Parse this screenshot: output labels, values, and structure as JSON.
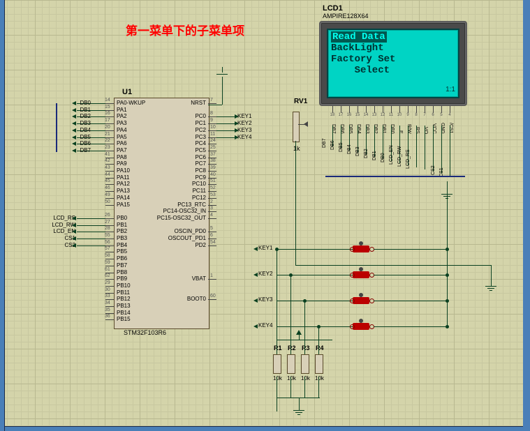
{
  "title": "第一菜单下的子菜单项",
  "lcd": {
    "ref": "LCD1",
    "part": "AMPIRE128X64",
    "lines": [
      "Read Data",
      "BackLight",
      "Factory Set",
      "    Select"
    ],
    "highlighted_index": 0,
    "corner": "1:1",
    "pins": [
      "DB7",
      "DB6",
      "DB5",
      "DB4",
      "DB3",
      "DB2",
      "DB1",
      "DB0",
      "E",
      "R/W",
      "RS",
      "VO",
      "VCC",
      "GND",
      "/CS1"
    ]
  },
  "mcu": {
    "ref": "U1",
    "part": "STM32F103R6",
    "left_pins": [
      {
        "n": "14",
        "name": "PA0-WKUP"
      },
      {
        "n": "15",
        "name": "PA1"
      },
      {
        "n": "16",
        "name": "PA2"
      },
      {
        "n": "17",
        "name": "PA3"
      },
      {
        "n": "20",
        "name": "PA4"
      },
      {
        "n": "21",
        "name": "PA5"
      },
      {
        "n": "22",
        "name": "PA6"
      },
      {
        "n": "23",
        "name": "PA7"
      },
      {
        "n": "41",
        "name": "PA8"
      },
      {
        "n": "42",
        "name": "PA9"
      },
      {
        "n": "43",
        "name": "PA10"
      },
      {
        "n": "44",
        "name": "PA11"
      },
      {
        "n": "45",
        "name": "PA12"
      },
      {
        "n": "46",
        "name": "PA13"
      },
      {
        "n": "49",
        "name": "PA14"
      },
      {
        "n": "50",
        "name": "PA15"
      },
      {
        "n": "",
        "name": ""
      },
      {
        "n": "26",
        "name": "PB0"
      },
      {
        "n": "27",
        "name": "PB1"
      },
      {
        "n": "28",
        "name": "PB2"
      },
      {
        "n": "55",
        "name": "PB3"
      },
      {
        "n": "56",
        "name": "PB4"
      },
      {
        "n": "57",
        "name": "PB5"
      },
      {
        "n": "58",
        "name": "PB6"
      },
      {
        "n": "59",
        "name": "PB7"
      },
      {
        "n": "61",
        "name": "PB8"
      },
      {
        "n": "62",
        "name": "PB9"
      },
      {
        "n": "29",
        "name": "PB10"
      },
      {
        "n": "30",
        "name": "PB11"
      },
      {
        "n": "33",
        "name": "PB12"
      },
      {
        "n": "34",
        "name": "PB13"
      },
      {
        "n": "35",
        "name": "PB14"
      },
      {
        "n": "36",
        "name": "PB15"
      }
    ],
    "right_pins": [
      {
        "n": "7",
        "name": "NRST"
      },
      {
        "n": "",
        "name": ""
      },
      {
        "n": "8",
        "name": "PC0"
      },
      {
        "n": "9",
        "name": "PC1"
      },
      {
        "n": "10",
        "name": "PC2"
      },
      {
        "n": "11",
        "name": "PC3"
      },
      {
        "n": "24",
        "name": "PC4"
      },
      {
        "n": "25",
        "name": "PC5"
      },
      {
        "n": "37",
        "name": "PC6"
      },
      {
        "n": "38",
        "name": "PC7"
      },
      {
        "n": "39",
        "name": "PC8"
      },
      {
        "n": "40",
        "name": "PC9"
      },
      {
        "n": "51",
        "name": "PC10"
      },
      {
        "n": "52",
        "name": "PC11"
      },
      {
        "n": "53",
        "name": "PC12"
      },
      {
        "n": "2",
        "name": "PC13_RTC"
      },
      {
        "n": "3",
        "name": "PC14-OSC32_IN"
      },
      {
        "n": "4",
        "name": "PC15-OSC32_OUT"
      },
      {
        "n": "",
        "name": ""
      },
      {
        "n": "5",
        "name": "OSCIN_PD0"
      },
      {
        "n": "6",
        "name": "OSCOUT_PD1"
      },
      {
        "n": "54",
        "name": "PD2"
      },
      {
        "n": "",
        "name": ""
      },
      {
        "n": "",
        "name": ""
      },
      {
        "n": "",
        "name": ""
      },
      {
        "n": "",
        "name": ""
      },
      {
        "n": "1",
        "name": "VBAT"
      },
      {
        "n": "",
        "name": ""
      },
      {
        "n": "",
        "name": ""
      },
      {
        "n": "60",
        "name": "BOOT0"
      }
    ],
    "left_nets_top": [
      "DB0",
      "DB1",
      "DB2",
      "DB3",
      "DB4",
      "DB5",
      "DB6",
      "DB7"
    ],
    "left_nets_pb": [
      "LCD_RS",
      "LCD_RW",
      "LCD_EN",
      "CS1",
      "CS2"
    ],
    "right_nets_pc": [
      "KEY1",
      "KEY2",
      "KEY3",
      "KEY4"
    ]
  },
  "rv": {
    "ref": "RV1",
    "value": "1k"
  },
  "keys": [
    "KEY1",
    "KEY2",
    "KEY3",
    "KEY4"
  ],
  "resistors": [
    {
      "ref": "R1",
      "val": "10k"
    },
    {
      "ref": "R2",
      "val": "10k"
    },
    {
      "ref": "R3",
      "val": "10k"
    },
    {
      "ref": "R4",
      "val": "10k"
    }
  ],
  "lcd_bus_nets": [
    "DB7",
    "DB6",
    "DB5",
    "DB4",
    "DB3",
    "DB2",
    "DB1",
    "DB0",
    "LCD_EN",
    "LCD_RW",
    "LCD_RS",
    "",
    "",
    "CS2",
    "CS1"
  ]
}
